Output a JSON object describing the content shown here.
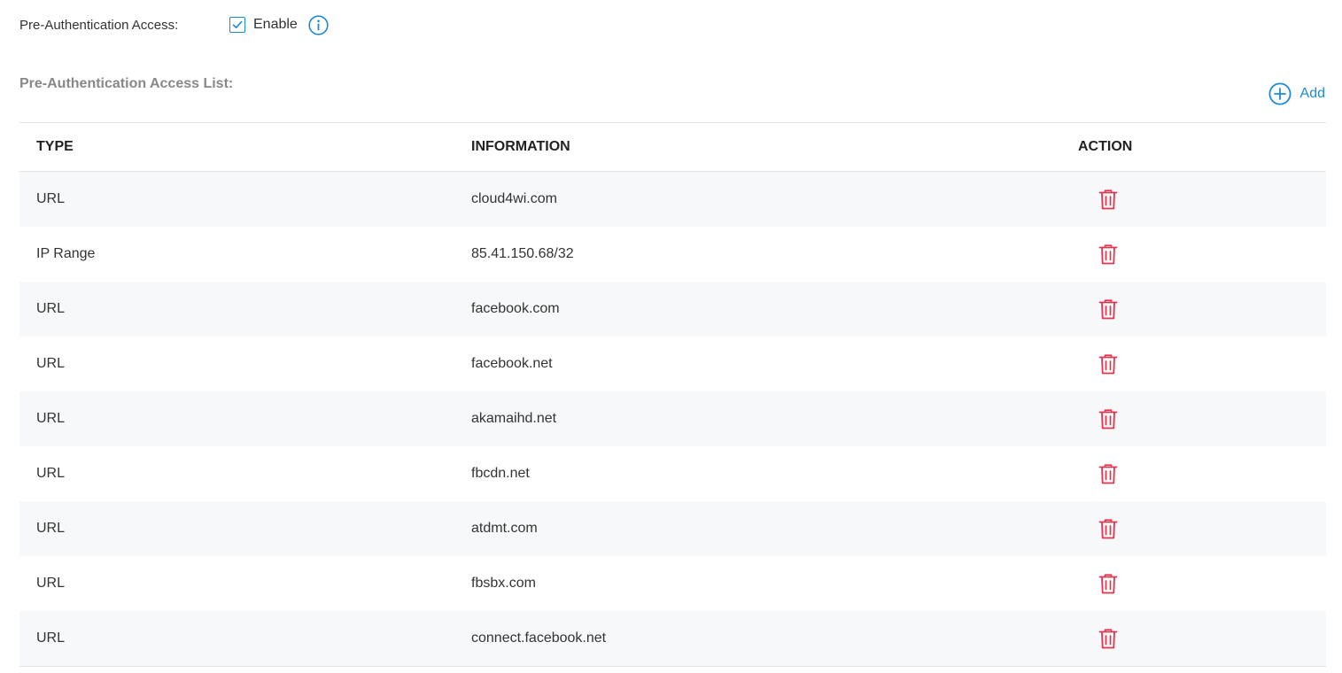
{
  "pre_auth": {
    "label": "Pre-Authentication Access:",
    "enable_label": "Enable",
    "enabled": true
  },
  "list": {
    "title": "Pre-Authentication Access List:",
    "add_label": "Add",
    "columns": {
      "type": "TYPE",
      "information": "INFORMATION",
      "action": "ACTION"
    },
    "rows": [
      {
        "type": "URL",
        "information": "cloud4wi.com"
      },
      {
        "type": "IP Range",
        "information": "85.41.150.68/32"
      },
      {
        "type": "URL",
        "information": "facebook.com"
      },
      {
        "type": "URL",
        "information": "facebook.net"
      },
      {
        "type": "URL",
        "information": "akamaihd.net"
      },
      {
        "type": "URL",
        "information": "fbcdn.net"
      },
      {
        "type": "URL",
        "information": "atdmt.com"
      },
      {
        "type": "URL",
        "information": "fbsbx.com"
      },
      {
        "type": "URL",
        "information": "connect.facebook.net"
      }
    ]
  },
  "colors": {
    "accent": "#1b8ad8",
    "delete": "#e3344f",
    "stripe": "#f7f8f9"
  },
  "icons": {
    "checkbox": "check-icon",
    "info": "info-icon",
    "add": "plus-circle-icon",
    "delete": "trash-icon"
  }
}
